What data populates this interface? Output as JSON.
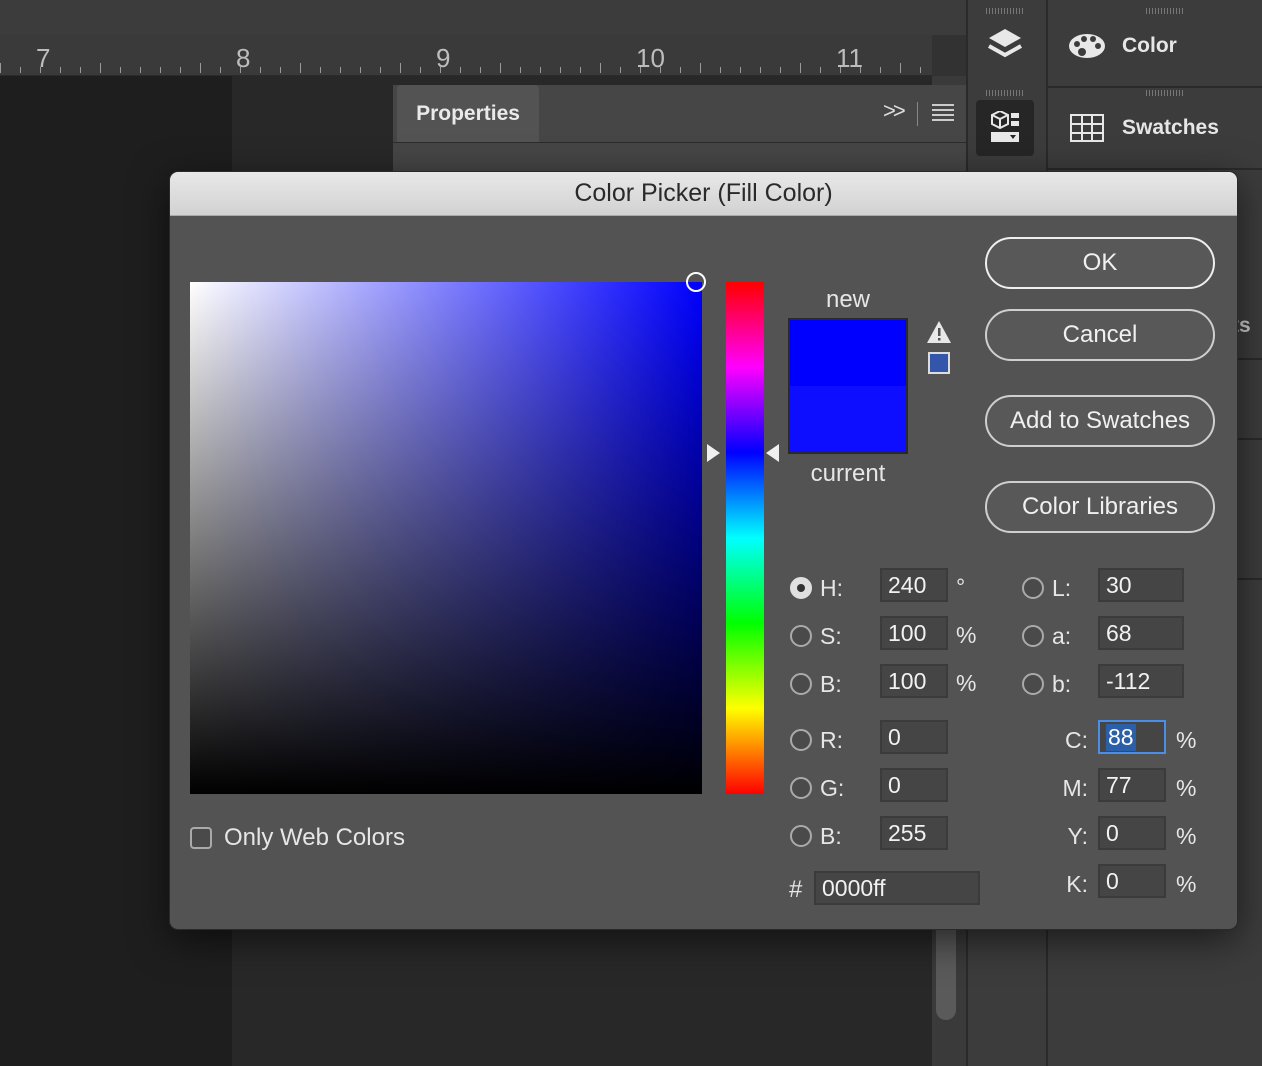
{
  "ruler": {
    "numbers": [
      "7",
      "8",
      "9",
      "10",
      "11"
    ]
  },
  "properties_panel": {
    "tab_label": "Properties",
    "collapse_glyph": ">>",
    "menu_icon": "menu-icon"
  },
  "side_panels": [
    {
      "label": "Color",
      "icon": "palette-icon"
    },
    {
      "label": "Swatches",
      "icon": "swatches-grid-icon"
    }
  ],
  "cut_panel_text": "ts",
  "dialog": {
    "title": "Color Picker (Fill Color)",
    "buttons": {
      "ok": "OK",
      "cancel": "Cancel",
      "add_to_swatches": "Add to Swatches",
      "color_libraries": "Color Libraries"
    },
    "preview": {
      "new_label": "new",
      "current_label": "current",
      "new_color": "#0000ff",
      "current_color": "#0d0dff"
    },
    "websafe_swatch_color": "#3355aa",
    "only_web_colors": {
      "label": "Only Web Colors",
      "checked": false
    },
    "hsb": [
      {
        "label": "H:",
        "value": "240",
        "unit": "°",
        "selected": true
      },
      {
        "label": "S:",
        "value": "100",
        "unit": "%",
        "selected": false
      },
      {
        "label": "B:",
        "value": "100",
        "unit": "%",
        "selected": false
      }
    ],
    "rgb": [
      {
        "label": "R:",
        "value": "0",
        "selected": false
      },
      {
        "label": "G:",
        "value": "0",
        "selected": false
      },
      {
        "label": "B:",
        "value": "255",
        "selected": false
      }
    ],
    "lab": [
      {
        "label": "L:",
        "value": "30",
        "selected": false
      },
      {
        "label": "a:",
        "value": "68",
        "selected": false
      },
      {
        "label": "b:",
        "value": "-112",
        "selected": false
      }
    ],
    "cmyk": [
      {
        "label": "C:",
        "value": "88",
        "unit": "%"
      },
      {
        "label": "M:",
        "value": "77",
        "unit": "%"
      },
      {
        "label": "Y:",
        "value": "0",
        "unit": "%"
      },
      {
        "label": "K:",
        "value": "0",
        "unit": "%"
      }
    ],
    "hex": {
      "label": "#",
      "value": "0000ff"
    },
    "hue_degrees": 240
  }
}
